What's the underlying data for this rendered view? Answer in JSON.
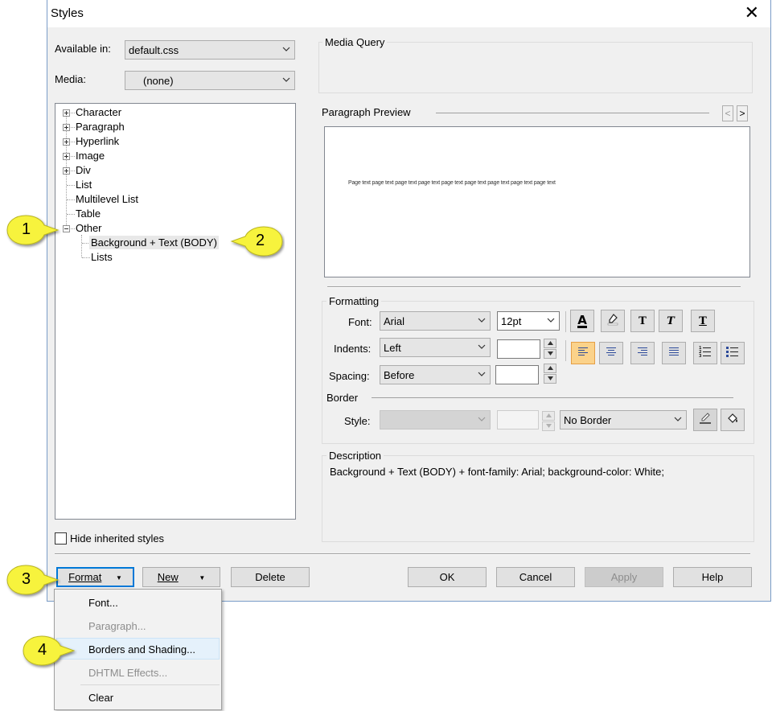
{
  "window": {
    "title": "Styles"
  },
  "available_in": {
    "label": "Available in:",
    "value": "default.css"
  },
  "media": {
    "label": "Media:",
    "value": "(none)"
  },
  "media_query": {
    "label": "Media Query"
  },
  "tree": {
    "items": [
      {
        "label": "Character"
      },
      {
        "label": "Paragraph"
      },
      {
        "label": "Hyperlink"
      },
      {
        "label": "Image"
      },
      {
        "label": "Div"
      },
      {
        "label": "List"
      },
      {
        "label": "Multilevel List"
      },
      {
        "label": "Table"
      },
      {
        "label": "Other"
      }
    ],
    "children": [
      {
        "label": "Background + Text (BODY)"
      },
      {
        "label": "Lists"
      }
    ]
  },
  "hide_inherited": {
    "label": "Hide inherited styles",
    "checked": false
  },
  "preview": {
    "label": "Paragraph Preview",
    "prev": "<",
    "next": ">",
    "text": "Page text page text page text page text page text page text page text page text page text"
  },
  "formatting": {
    "label": "Formatting",
    "font_label": "Font:",
    "font_value": "Arial",
    "size_value": "12pt",
    "indents_label": "Indents:",
    "indents_value": "Left",
    "spacing_label": "Spacing:",
    "spacing_value": "Before",
    "bold_glyph": "T",
    "italic_glyph": "T",
    "underline_glyph": "T"
  },
  "border": {
    "label": "Border",
    "style_label": "Style:",
    "value": "No Border"
  },
  "description": {
    "label": "Description",
    "text": "Background + Text (BODY) +  font-family: Arial;  background-color: White;"
  },
  "buttons": {
    "format": "Format",
    "new": "New",
    "delete": "Delete",
    "ok": "OK",
    "cancel": "Cancel",
    "apply": "Apply",
    "help": "Help"
  },
  "format_menu": [
    {
      "label": "Font...",
      "enabled": true
    },
    {
      "label": "Paragraph...",
      "enabled": false
    },
    {
      "label": "Borders and Shading...",
      "enabled": true
    },
    {
      "label": "DHTML Effects...",
      "enabled": false
    },
    {
      "label": "Clear",
      "enabled": true
    }
  ],
  "callouts": [
    "1",
    "2",
    "3",
    "4"
  ],
  "colors": {
    "callout": "#f7f33c",
    "selected_align": "#fbd28a",
    "menu_highlight": "#e5f1fb"
  }
}
